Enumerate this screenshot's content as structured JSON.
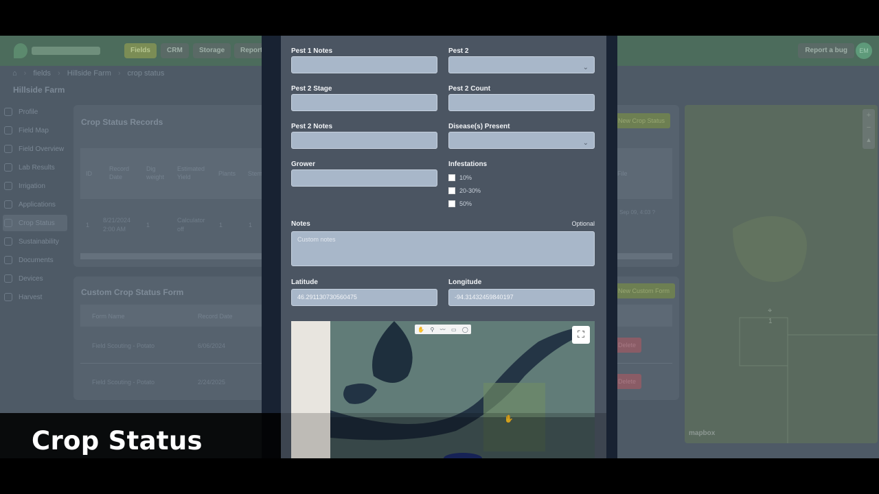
{
  "app": {
    "nav": [
      "Fields",
      "CRM",
      "Storage",
      "Reports"
    ],
    "report_bug": "Report a bug",
    "avatar_initials": "EM",
    "breadcrumb": [
      "fields",
      "Hillside Farm",
      "crop status"
    ],
    "farm_title": "Hillside Farm",
    "sidebar": [
      "Profile",
      "Field Map",
      "Field Overview",
      "Lab Results",
      "Irrigation",
      "Applications",
      "Crop Status",
      "Sustainability",
      "Documents",
      "Devices",
      "Harvest"
    ]
  },
  "records": {
    "title": "Crop Status Records",
    "new_button": "New Crop Status",
    "headers": [
      "ID",
      "Record Date",
      "Dig weight",
      "Estimated Yield",
      "Plants",
      "Stem"
    ],
    "extra_header": "File",
    "row": {
      "id": "1",
      "date_line1": "8/21/2024",
      "date_line2": "2:00 AM",
      "dig_weight": "1",
      "yield_line1": "Calculator",
      "yield_line2": "off",
      "plants": "1",
      "stems": "1",
      "updated": "Sep 09, 4:03 ?"
    }
  },
  "custom_forms": {
    "title": "Custom Crop Status Form",
    "new_button": "New Custom Form",
    "headers": [
      "Form Name",
      "Record Date"
    ],
    "rows": [
      {
        "name": "Field Scouting - Potato",
        "date": "6/06/2024",
        "action": "Delete"
      },
      {
        "name": "Field Scouting - Potato",
        "date": "2/24/2025",
        "action": "Delete"
      }
    ]
  },
  "bg_map": {
    "pin_label": "1",
    "attribution": "mapbox"
  },
  "form": {
    "pest1_notes_label": "Pest 1 Notes",
    "pest2_label": "Pest 2",
    "pest2_stage_label": "Pest 2 Stage",
    "pest2_count_label": "Pest 2 Count",
    "pest2_notes_label": "Pest 2 Notes",
    "disease_label": "Disease(s) Present",
    "grower_label": "Grower",
    "infestations_label": "Infestations",
    "infestations": [
      "10%",
      "20-30%",
      "50%"
    ],
    "notes_label": "Notes",
    "notes_optional": "Optional",
    "notes_placeholder": "Custom notes",
    "latitude_label": "Latitude",
    "latitude_value": "46.291130730560475",
    "longitude_label": "Longitude",
    "longitude_value": "-94.31432459840197"
  },
  "caption": "Crop Status"
}
